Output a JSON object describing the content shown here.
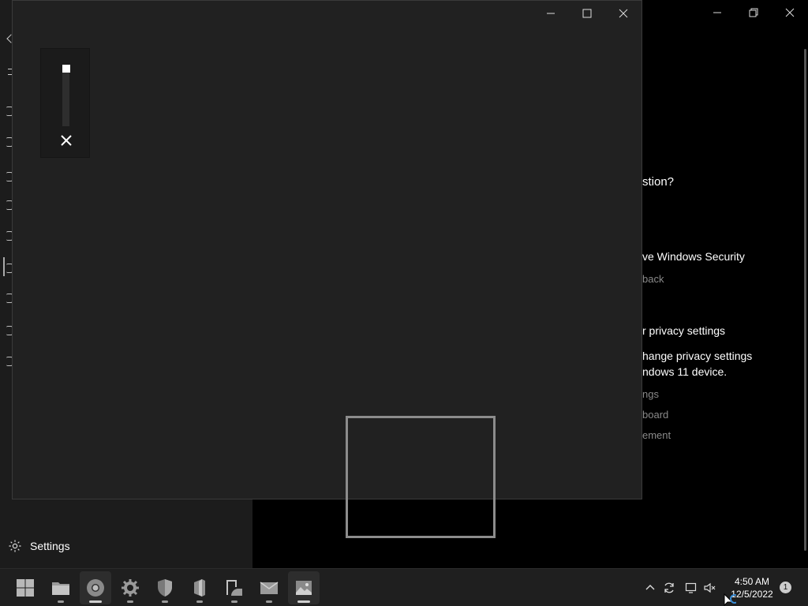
{
  "background_window": {
    "heading_partial": "stion?",
    "section1_title": "ve Windows Security",
    "section1_link": "back",
    "section2_title": "r privacy settings",
    "section2_line1": "hange privacy settings",
    "section2_line2": "ndows 11 device.",
    "link1": "ngs",
    "link2": "board",
    "link3": "ement",
    "settings_label": "Settings"
  },
  "taskbar": {
    "apps": [
      {
        "name": "start",
        "icon": "windows-logo-icon"
      },
      {
        "name": "file-explorer",
        "icon": "folder-icon"
      },
      {
        "name": "chrome",
        "icon": "chrome-icon"
      },
      {
        "name": "settings",
        "icon": "gear-icon"
      },
      {
        "name": "windows-security",
        "icon": "shield-icon"
      },
      {
        "name": "office",
        "icon": "office-icon"
      },
      {
        "name": "photo-editor",
        "icon": "photo-edit-icon"
      },
      {
        "name": "mail",
        "icon": "mail-icon"
      },
      {
        "name": "photos",
        "icon": "photos-icon"
      }
    ],
    "time": "4:50 AM",
    "date": "12/5/2022",
    "notification_count": "1"
  }
}
